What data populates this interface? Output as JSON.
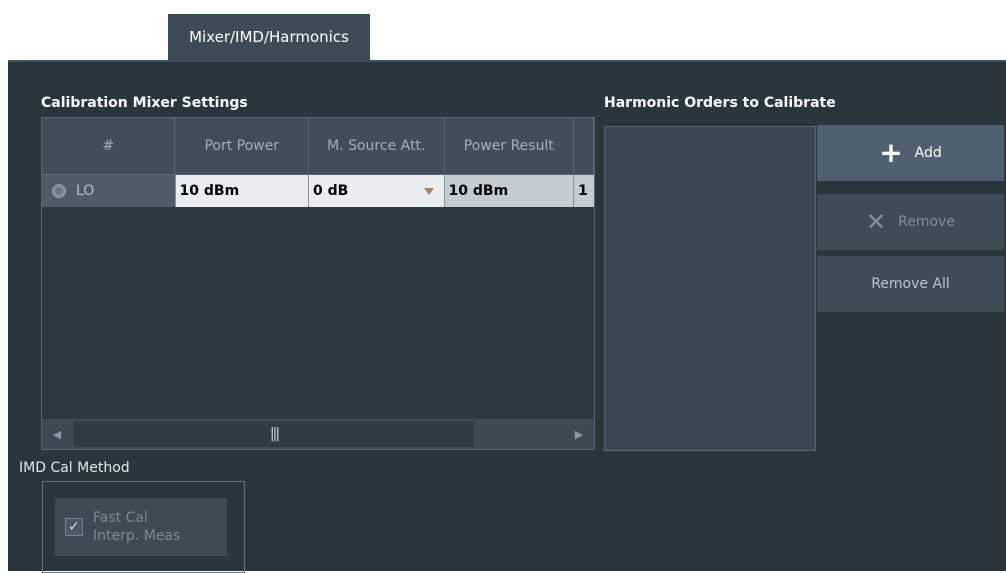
{
  "tab": {
    "label": "Mixer/IMD/Harmonics"
  },
  "calibration": {
    "title": "Calibration Mixer Settings",
    "columns": [
      "#",
      "Port Power",
      "M. Source Att.",
      "Power Result"
    ],
    "rows": [
      {
        "id": "LO",
        "port_power": "10 dBm",
        "m_source_att": "0 dB",
        "power_result": "10 dBm",
        "overflow": "1"
      }
    ]
  },
  "harmonics": {
    "title": "Harmonic Orders to Calibrate",
    "add_label": "Add",
    "remove_label": "Remove",
    "remove_all_label": "Remove All"
  },
  "imd": {
    "title": "IMD Cal Method",
    "checkbox_label_line1": "Fast Cal",
    "checkbox_label_line2": "Interp. Meas",
    "checked": true
  },
  "icons": {
    "add": "plus-icon",
    "remove": "x-icon",
    "scroll_left": "triangle-left-icon",
    "scroll_right": "triangle-right-icon",
    "grip": "grip-icon",
    "dropdown": "chevron-down-icon"
  },
  "colors": {
    "panel_bg": "#2a363d",
    "tab_bg": "#3b4c56",
    "accent_arrow": "#b47a63"
  }
}
